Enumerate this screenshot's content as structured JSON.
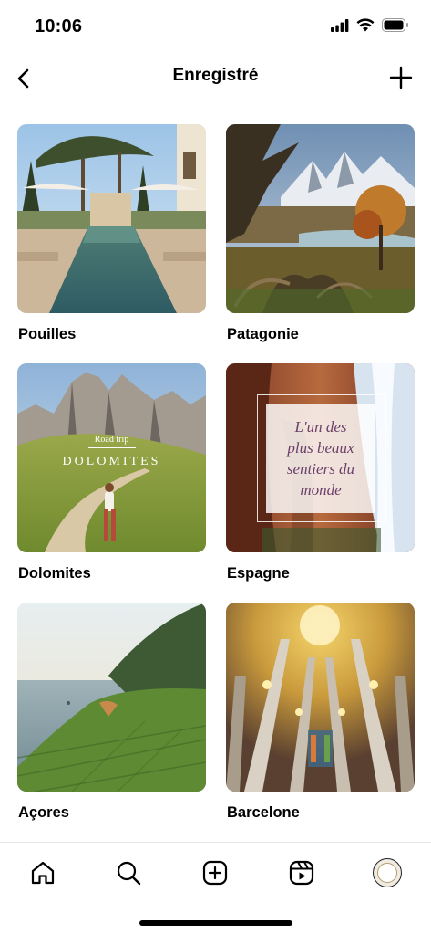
{
  "status_bar": {
    "time": "10:06"
  },
  "header": {
    "title": "Enregistré"
  },
  "collections": [
    {
      "name": "Pouilles"
    },
    {
      "name": "Patagonie"
    },
    {
      "name": "Dolomites",
      "overlay_small": "Road trip",
      "overlay_big": "DOLOMITES"
    },
    {
      "name": "Espagne",
      "overlay_quote": [
        "L'un des",
        "plus beaux",
        "sentiers du",
        "monde"
      ]
    },
    {
      "name": "Açores"
    },
    {
      "name": "Barcelone"
    }
  ],
  "tab_bar": {
    "items": [
      "home-icon",
      "search-icon",
      "create-icon",
      "reels-icon",
      "profile-avatar"
    ]
  },
  "colors": {
    "accent": "#000000",
    "divider": "#e6e6e6"
  }
}
